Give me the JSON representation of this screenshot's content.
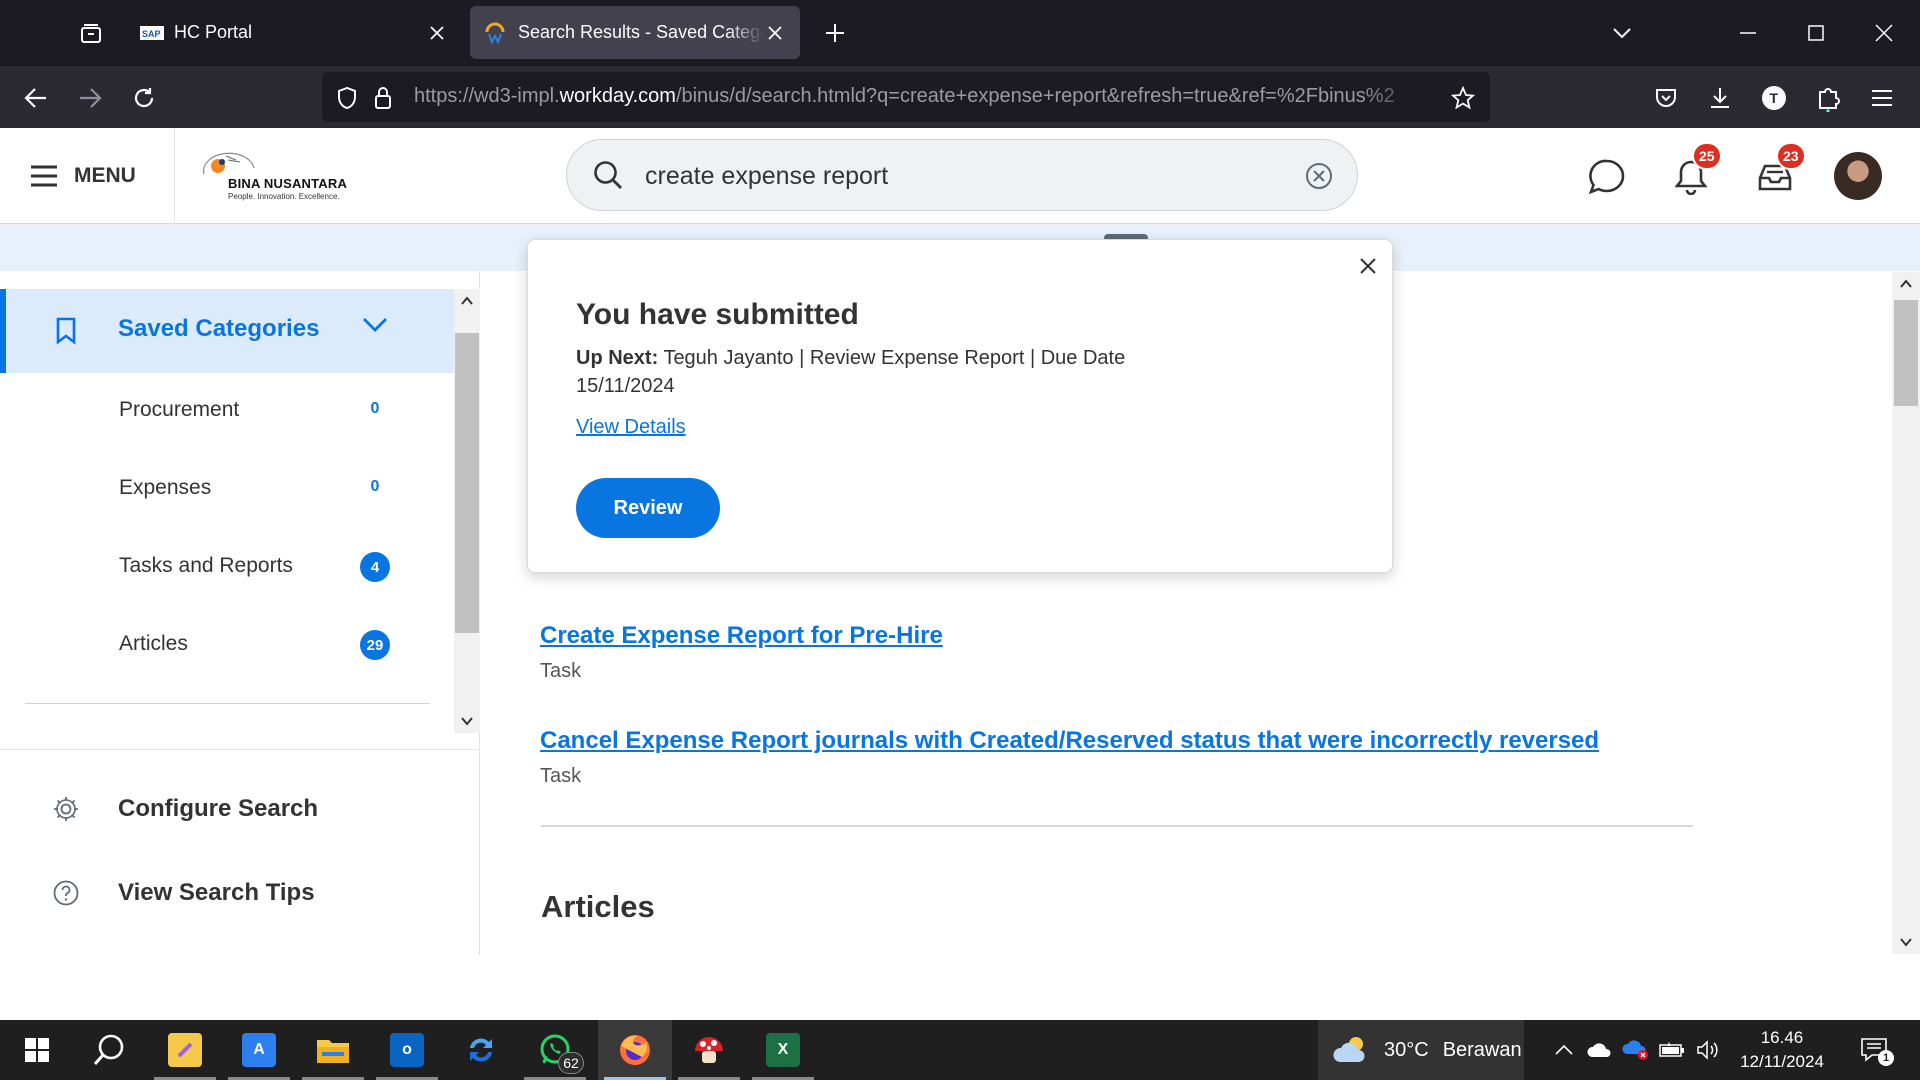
{
  "browser": {
    "tabs": [
      {
        "title": "HC Portal",
        "favicon": "sap-icon",
        "active": false
      },
      {
        "title": "Search Results - Saved Categories",
        "favicon": "workday-icon",
        "active": true
      }
    ],
    "url_prefix": "https://wd3-impl.",
    "url_domain": "workday.com",
    "url_rest": "/binus/d/search.htmld?q=create+expense+report&refresh=true&ref=%2Fbinus%2"
  },
  "header": {
    "menu_label": "MENU",
    "logo_brand": "BINA NUSANTARA",
    "logo_tagline": "People.  Innovation.  Excellence.",
    "search_value": "create expense report",
    "notifications_count": "25",
    "inbox_count": "23"
  },
  "sidebar": {
    "section_title": "Saved Categories",
    "items": [
      {
        "label": "Procurement",
        "count": "0"
      },
      {
        "label": "Expenses",
        "count": "0"
      },
      {
        "label": "Tasks and Reports",
        "count": "4"
      },
      {
        "label": "Articles",
        "count": "29"
      }
    ],
    "actions": [
      {
        "label": "Configure Search",
        "icon": "gear-icon"
      },
      {
        "label": "View Search Tips",
        "icon": "help-icon"
      }
    ]
  },
  "popup": {
    "heading": "You have submitted",
    "up_next_label": "Up Next:",
    "up_next_text": "Teguh Jayanto | Review Expense Report | Due Date 15/11/2024",
    "link_label": "View Details",
    "button_label": "Review"
  },
  "results": [
    {
      "title": "Create Expense Report for Pre-Hire",
      "type": "Task"
    },
    {
      "title": "Cancel Expense Report journals with Created/Reserved status that were incorrectly reversed",
      "type": "Task"
    }
  ],
  "sections": {
    "articles_title": "Articles"
  },
  "taskbar": {
    "whatsapp_badge": "62",
    "weather_temp": "30°C",
    "weather_condition": "Berawan",
    "time": "16.46",
    "date": "12/11/2024",
    "notification_count": "1"
  },
  "colors": {
    "accent": "#0875e1",
    "badge_red": "#de2e21",
    "browser_dark": "#1c1b22"
  }
}
